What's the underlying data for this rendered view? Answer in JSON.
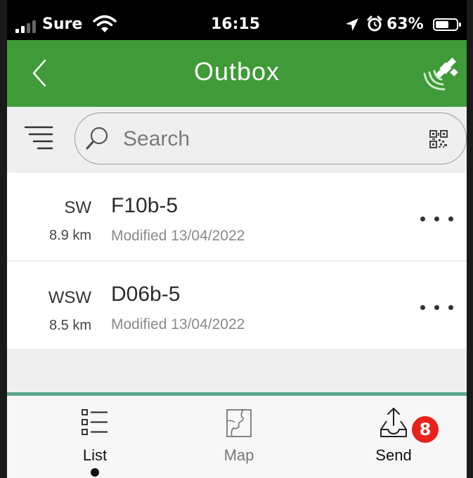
{
  "status_bar": {
    "carrier": "Sure",
    "time": "16:15",
    "battery_percent": "63%",
    "battery_level": 0.63,
    "icons": [
      "signal-icon",
      "wifi-icon",
      "location-arrow-icon",
      "alarm-icon",
      "battery-icon"
    ]
  },
  "header": {
    "title": "Outbox",
    "back_icon": "chevron-left-icon",
    "gps_icon": "satellite-signal-icon"
  },
  "search": {
    "placeholder": "Search",
    "filter_icon": "filter-lines-icon",
    "search_icon": "magnifier-icon",
    "qr_icon": "qr-code-icon"
  },
  "items": [
    {
      "direction": "SW",
      "distance": "8.9 km",
      "name": "F10b-5",
      "modified": "Modified 13/04/2022"
    },
    {
      "direction": "WSW",
      "distance": "8.5 km",
      "name": "D06b-5",
      "modified": "Modified 13/04/2022"
    }
  ],
  "tabs": {
    "list": {
      "label": "List",
      "icon": "list-icon",
      "active": true
    },
    "map": {
      "label": "Map",
      "icon": "map-icon",
      "active": false
    },
    "send": {
      "label": "Send",
      "icon": "send-tray-icon",
      "badge": "8",
      "active": false
    }
  },
  "colors": {
    "header_green": "#3f9a38",
    "badge_red": "#e8231c",
    "tab_divider": "#5aa88a"
  }
}
